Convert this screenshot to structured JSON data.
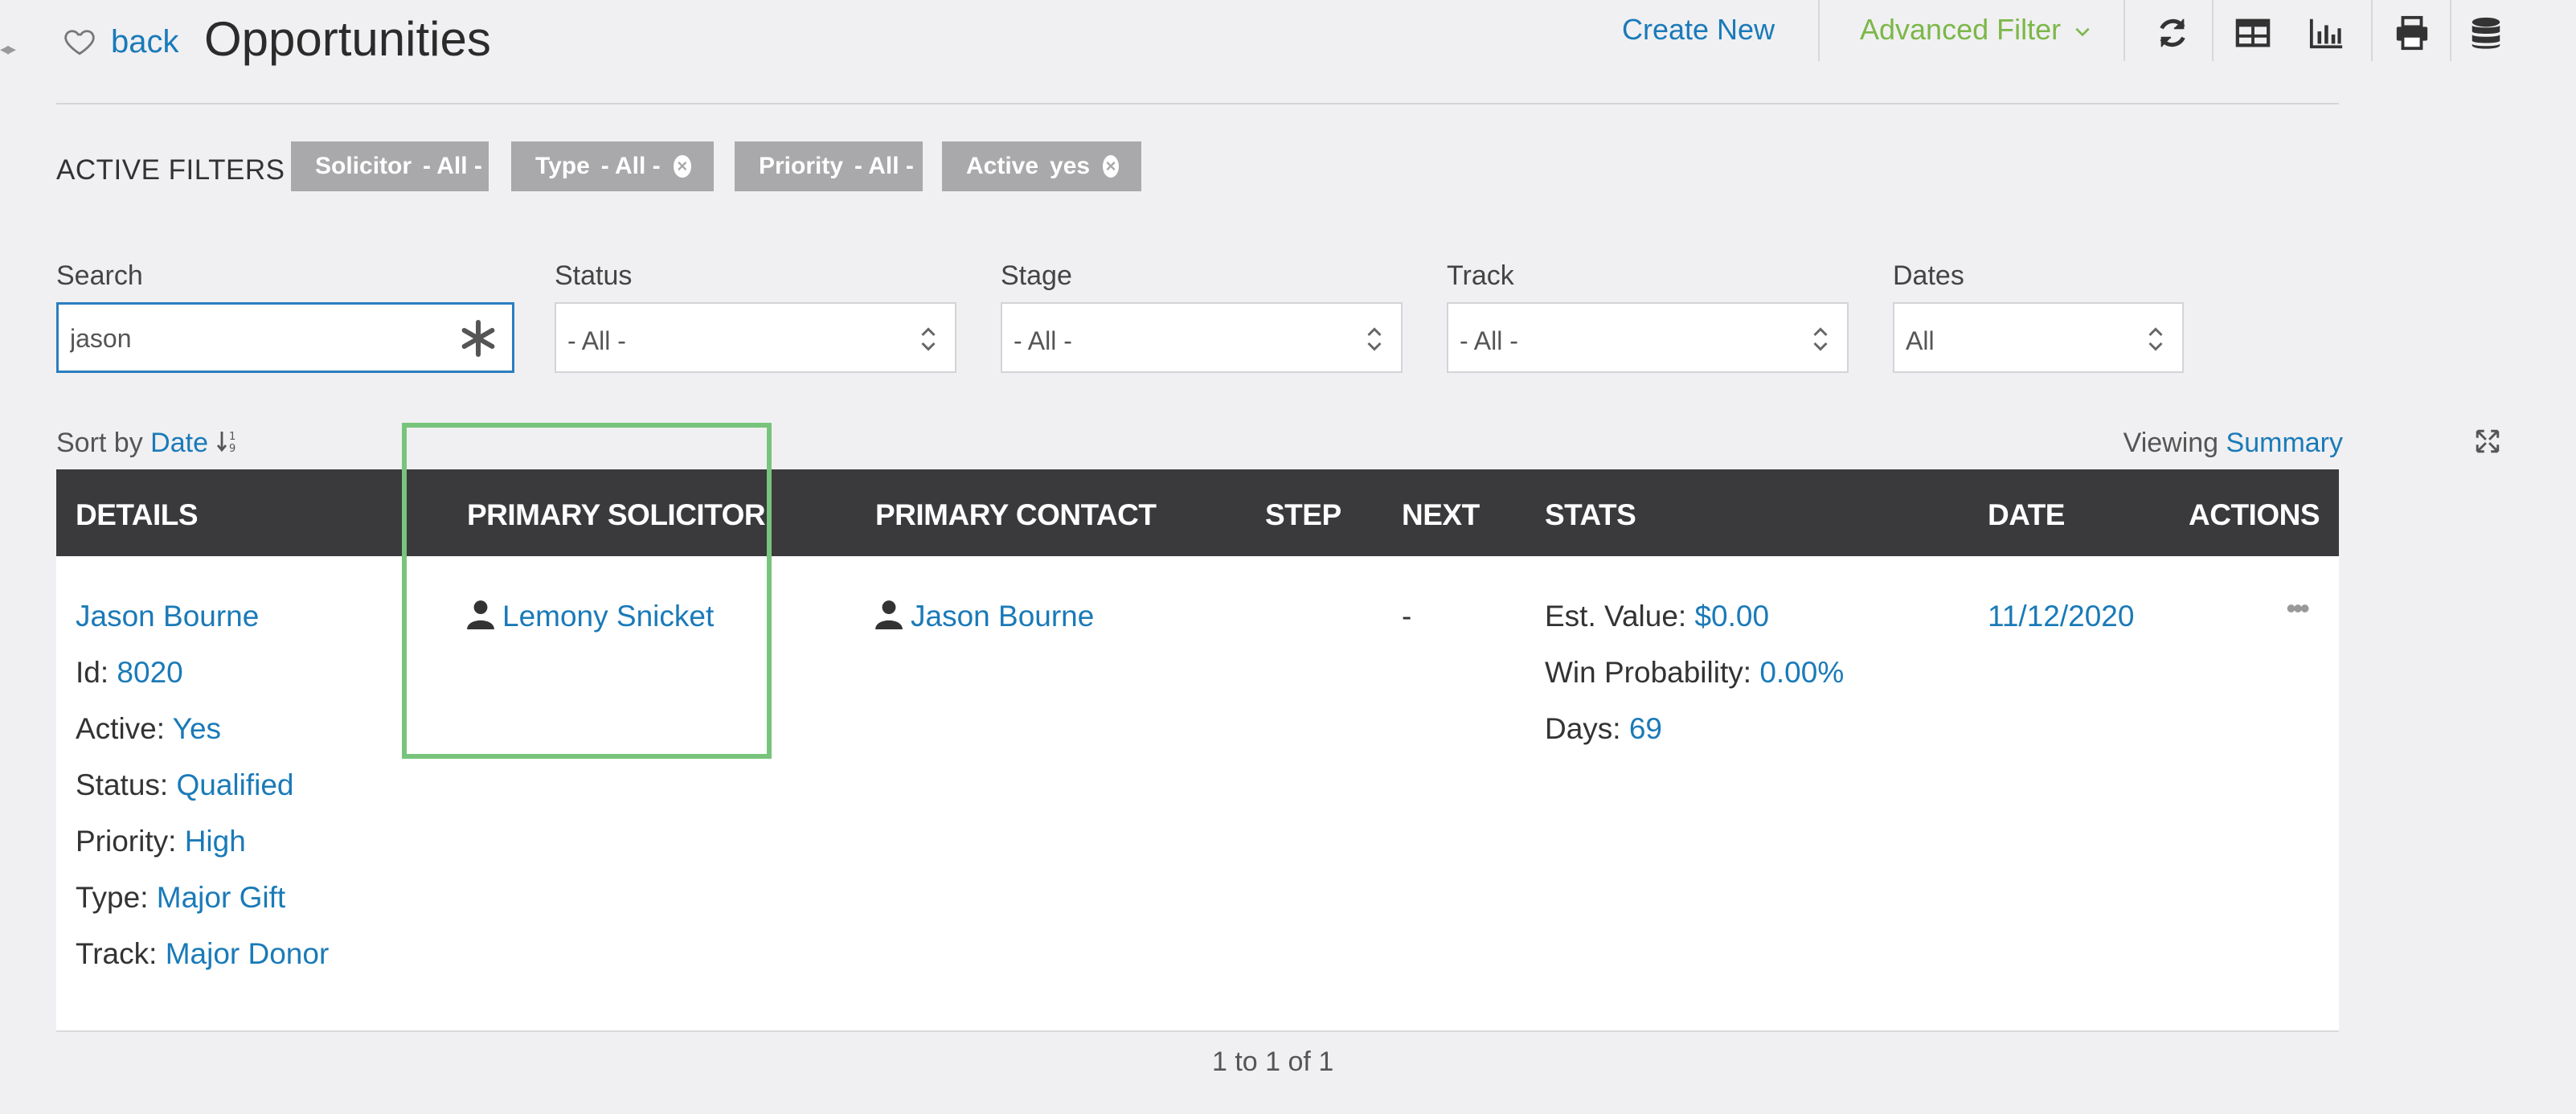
{
  "header": {
    "back_label": "back",
    "page_title": "Opportunities",
    "create_new_label": "Create New",
    "advanced_filter_label": "Advanced Filter",
    "tool_icons": [
      "refresh-icon",
      "table-view-icon",
      "chart-icon",
      "print-icon",
      "database-icon"
    ]
  },
  "active_filters": {
    "label": "ACTIVE FILTERS",
    "chips": [
      {
        "name": "Solicitor",
        "value": "- All -",
        "removable": false
      },
      {
        "name": "Type",
        "value": "- All -",
        "removable": true
      },
      {
        "name": "Priority",
        "value": "- All -",
        "removable": false
      },
      {
        "name": "Active",
        "value": "yes",
        "removable": true
      }
    ]
  },
  "filters": {
    "search": {
      "label": "Search",
      "value": "jason"
    },
    "status": {
      "label": "Status",
      "value": "- All -"
    },
    "stage": {
      "label": "Stage",
      "value": "- All -"
    },
    "track": {
      "label": "Track",
      "value": "- All -"
    },
    "dates": {
      "label": "Dates",
      "value": "All"
    }
  },
  "sort": {
    "label": "Sort by",
    "field": "Date"
  },
  "viewing": {
    "label": "Viewing",
    "mode": "Summary"
  },
  "table": {
    "columns": [
      "DETAILS",
      "PRIMARY SOLICITOR",
      "PRIMARY CONTACT",
      "STEP",
      "NEXT",
      "STATS",
      "DATE",
      "ACTIONS"
    ],
    "rows": [
      {
        "details": {
          "name": "Jason Bourne",
          "id_label": "Id:",
          "id": "8020",
          "active_label": "Active:",
          "active": "Yes",
          "status_label": "Status:",
          "status": "Qualified",
          "priority_label": "Priority:",
          "priority": "High",
          "type_label": "Type:",
          "type": "Major Gift",
          "track_label": "Track:",
          "track": "Major Donor"
        },
        "primary_solicitor": "Lemony Snicket",
        "primary_contact": "Jason Bourne",
        "step": "",
        "next": "-",
        "stats": {
          "est_value_label": "Est. Value:",
          "est_value": "$0.00",
          "win_prob_label": "Win Probability:",
          "win_prob": "0.00%",
          "days_label": "Days:",
          "days": "69"
        },
        "date": "11/12/2020",
        "actions": "•••"
      }
    ]
  },
  "pager": "1 to 1 of 1",
  "colors": {
    "link": "#1a7ab8",
    "accent_green": "#7cb748",
    "header_bg": "#3a3a3d",
    "highlight": "#78c47c"
  }
}
